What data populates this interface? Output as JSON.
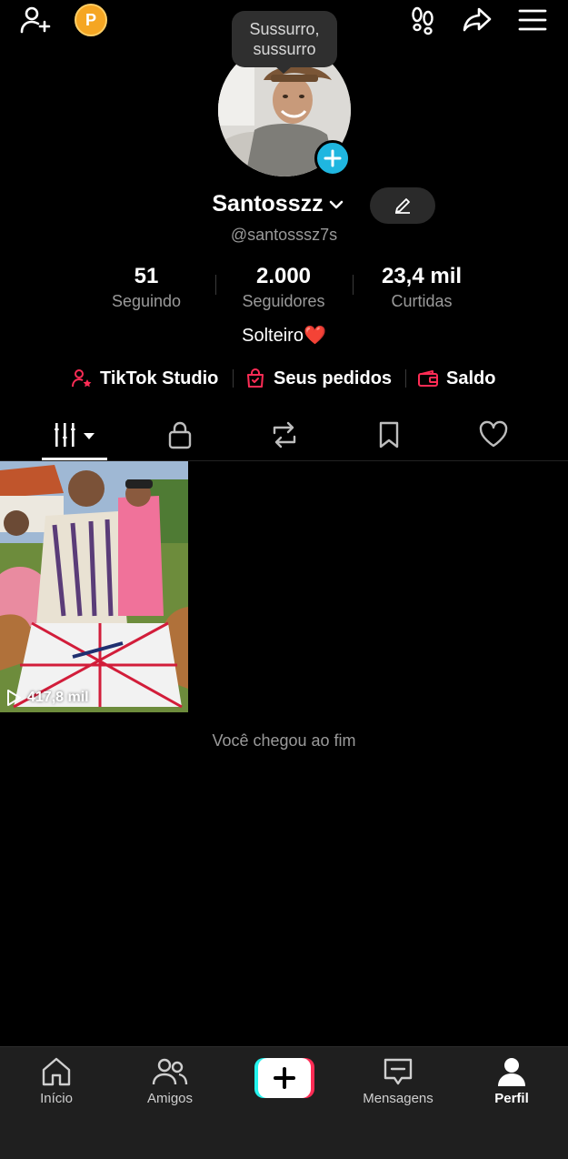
{
  "top": {
    "coin_letter": "P",
    "tooltip": "Sussurro, sussurro"
  },
  "profile": {
    "name": "Santosszz",
    "handle": "@santosssz7s",
    "bio": "Solteiro❤️",
    "stats": [
      {
        "value": "51",
        "label": "Seguindo"
      },
      {
        "value": "2.000",
        "label": "Seguidores"
      },
      {
        "value": "23,4 mil",
        "label": "Curtidas"
      }
    ]
  },
  "quick_links": [
    {
      "label": "TikTok Studio",
      "icon": "person-star-icon"
    },
    {
      "label": "Seus pedidos",
      "icon": "shopping-bag-icon"
    },
    {
      "label": "Saldo",
      "icon": "wallet-icon"
    }
  ],
  "tabs": [
    "videos-grid-icon",
    "lock-icon",
    "repost-icon",
    "bookmark-icon",
    "heart-icon"
  ],
  "videos": [
    {
      "views": "417,8 mil"
    }
  ],
  "end_message": "Você chegou ao fim",
  "bottom_nav": [
    {
      "label": "Início",
      "icon": "home-icon"
    },
    {
      "label": "Amigos",
      "icon": "friends-icon"
    },
    {
      "label": "",
      "icon": "create-icon"
    },
    {
      "label": "Mensagens",
      "icon": "messages-icon"
    },
    {
      "label": "Perfil",
      "icon": "profile-icon"
    }
  ],
  "colors": {
    "accent_red": "#fe2c55",
    "accent_cyan": "#25f4ee",
    "badge_blue": "#1fb6e0",
    "coin": "#f5a623"
  }
}
